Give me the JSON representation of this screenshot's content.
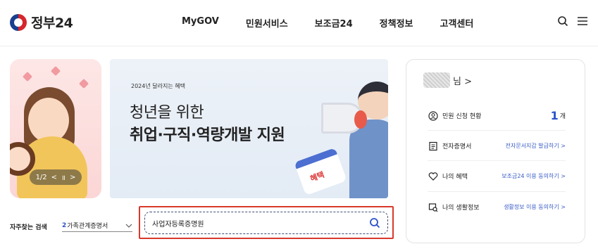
{
  "header": {
    "logo_text": "정부24",
    "nav": [
      "MyGOV",
      "민원서비스",
      "보조금24",
      "정책정보",
      "고객센터"
    ]
  },
  "hero": {
    "pager": {
      "current": "1/2",
      "prev": "<",
      "pause": "॥",
      "next": ">"
    }
  },
  "banner": {
    "small_text": "2024년 달라지는 혜택",
    "line1": "청년을 위한",
    "line2": "취업·구직·역량개발 지원",
    "badge": "혜택"
  },
  "side": {
    "user_suffix": "님 >",
    "rows": [
      {
        "icon": "person-circle-icon",
        "label": "민원 신청 현황",
        "count": "1",
        "unit": "개"
      },
      {
        "icon": "document-icon",
        "label": "전자증명서",
        "link": "전자문서지갑 발급하기 >"
      },
      {
        "icon": "heart-icon",
        "label": "나의 혜택",
        "link": "보조금24 이용 동의하기 >"
      },
      {
        "icon": "life-info-icon",
        "label": "나의 생활정보",
        "link": "생활정보 이용 동의하기 >"
      }
    ]
  },
  "frequent": {
    "label": "자주찾는 검색",
    "selected_number": "2",
    "selected_text": "가족관계증명서"
  },
  "search": {
    "value": "사업자등록증명원"
  },
  "colors": {
    "accent": "#2a52c9",
    "highlight": "#d8392c"
  }
}
